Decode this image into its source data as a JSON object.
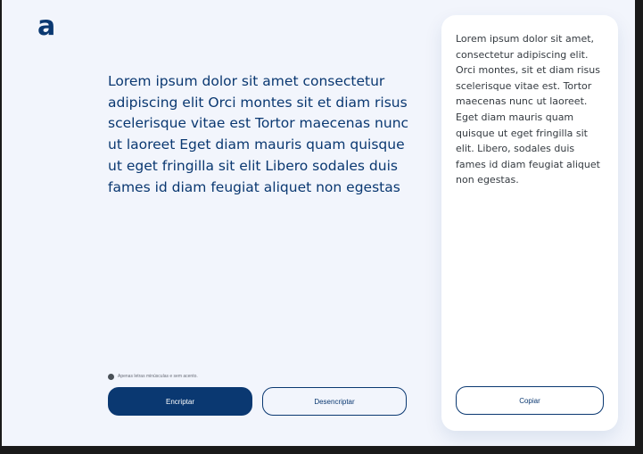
{
  "brand": {
    "logo_text": "a"
  },
  "input": {
    "text": "Lorem ipsum dolor sit amet consectetur adipiscing elit Orci montes sit et diam risus scelerisque vitae est Tortor maecenas nunc ut laoreet Eget diam mauris quam quisque ut eget fringilla sit elit Libero sodales duis fames id diam feugiat aliquet non egestas"
  },
  "hint": {
    "text": "Apenas letras minúsculas e sem acento."
  },
  "actions": {
    "encrypt_label": "Encriptar",
    "decrypt_label": "Desencriptar"
  },
  "output": {
    "text": "Lorem ipsum dolor sit amet, consectetur adipiscing elit. Orci montes, sit et diam risus scelerisque vitae est. Tortor maecenas nunc ut laoreet. Eget diam mauris quam quisque ut eget fringilla sit elit. Libero, sodales duis fames id diam feugiat aliquet non egestas.",
    "copy_label": "Copiar"
  },
  "colors": {
    "primary": "#0a3871",
    "background": "#f2f5fc",
    "panel": "#ffffff"
  }
}
